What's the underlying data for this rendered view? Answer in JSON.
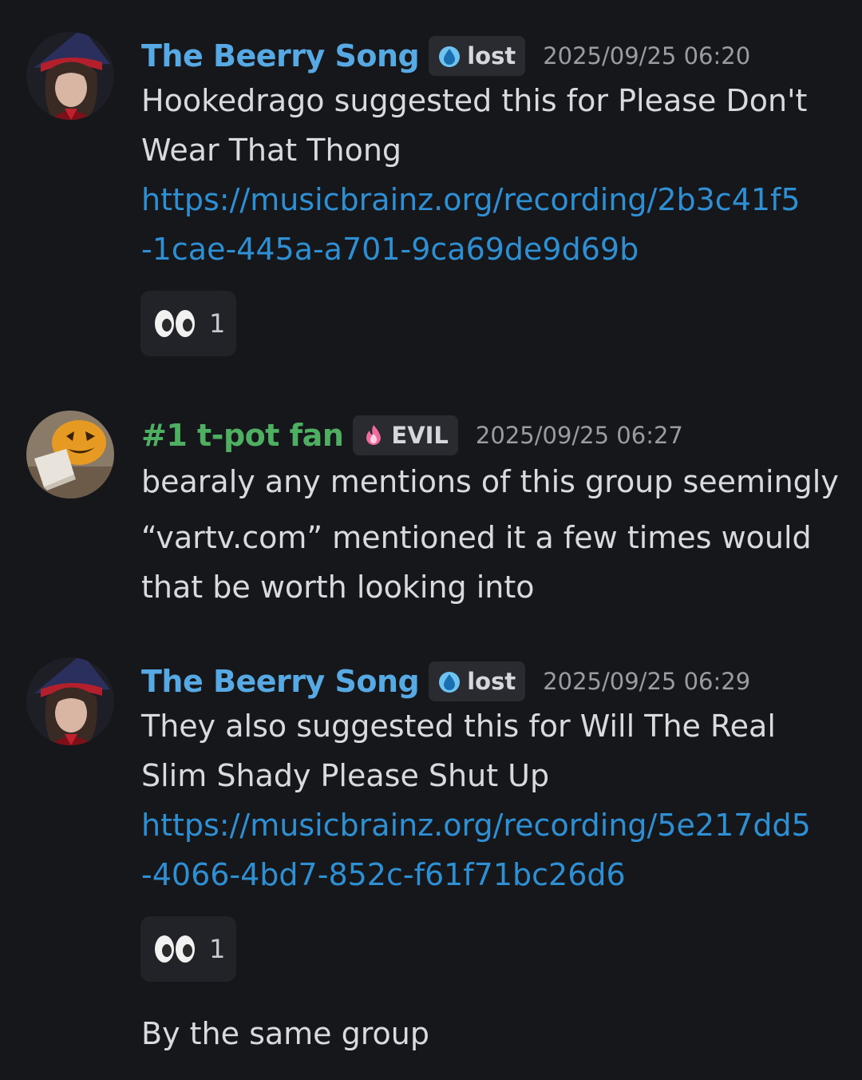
{
  "messages": [
    {
      "author": "The Beerry Song",
      "role_tag": "lost",
      "timestamp": "2025/09/25 06:20",
      "text_lines": [
        "Hookedrago suggested this for Please Don't",
        "Wear That Thong"
      ],
      "link_lines": [
        "https://musicbrainz.org/recording/2b3c41f5",
        "-1cae-445a-a701-9ca69de9d69b"
      ],
      "reaction": {
        "emoji": "eyes",
        "count": "1"
      }
    },
    {
      "author": "#1 t-pot fan",
      "role_tag": "EVIL",
      "timestamp": "2025/09/25 06:27",
      "text_lines": [
        "bearaly any mentions of this group seemingly",
        "“vartv.com” mentioned it a few times would",
        "that be worth looking into"
      ]
    },
    {
      "author": "The Beerry Song",
      "role_tag": "lost",
      "timestamp": "2025/09/25 06:29",
      "text_lines": [
        "They also suggested this for Will The Real",
        "Slim Shady Please Shut Up"
      ],
      "link_lines": [
        "https://musicbrainz.org/recording/5e217dd5",
        "-4066-4bd7-852c-f61f71bc26d6"
      ],
      "reaction": {
        "emoji": "eyes",
        "count": "1"
      },
      "followup": "By the same group"
    }
  ],
  "colors": {
    "background": "#16171b",
    "author_blue": "#57a9e3",
    "author_green": "#4eae61",
    "link": "#2f8fd3"
  },
  "icons": {
    "lost_tag": "water-drop-icon",
    "evil_tag": "pink-flame-icon",
    "reaction": "eyes-emoji-icon"
  }
}
